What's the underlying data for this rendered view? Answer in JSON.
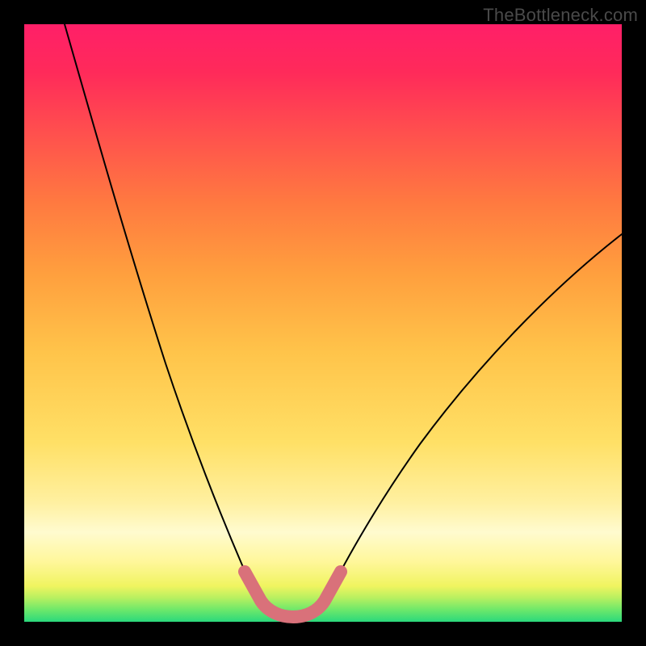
{
  "watermark": "TheBottleneck.com",
  "colors": {
    "frame": "#000000",
    "curve": "#000000",
    "highlight": "#d9717a"
  },
  "chart_data": {
    "type": "line",
    "title": "",
    "xlabel": "",
    "ylabel": "",
    "xlim": [
      0,
      100
    ],
    "ylim": [
      0,
      100
    ],
    "grid": false,
    "legend": false,
    "background_gradient": "red-to-green (top to bottom)",
    "series": [
      {
        "name": "curve",
        "x": [
          7,
          10,
          14,
          18,
          22,
          26,
          30,
          33,
          35,
          37,
          39,
          41,
          44,
          47,
          50,
          55,
          60,
          67,
          75,
          85,
          95,
          100
        ],
        "y": [
          100,
          85,
          70,
          56,
          44,
          32,
          22,
          14,
          8,
          4,
          2,
          1,
          1,
          2,
          4,
          8,
          14,
          22,
          32,
          45,
          58,
          65
        ]
      }
    ],
    "highlight_region": {
      "description": "U-shaped pink segment at curve minimum",
      "x_range": [
        35,
        50
      ],
      "y_range": [
        1,
        8
      ]
    }
  }
}
